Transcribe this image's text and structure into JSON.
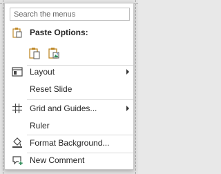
{
  "search": {
    "placeholder": "Search the menus"
  },
  "paste": {
    "header": "Paste Options:",
    "options": [
      "Use Destination Theme",
      "Picture"
    ]
  },
  "items": {
    "layout": "Layout",
    "reset": "Reset Slide",
    "grid": "Grid and Guides...",
    "ruler": "Ruler",
    "format_bg": "Format Background...",
    "new_comment": "New Comment"
  },
  "colors": {
    "clipboard": "#c08a2a",
    "accent": "#2e8b57",
    "icon": "#444444"
  }
}
